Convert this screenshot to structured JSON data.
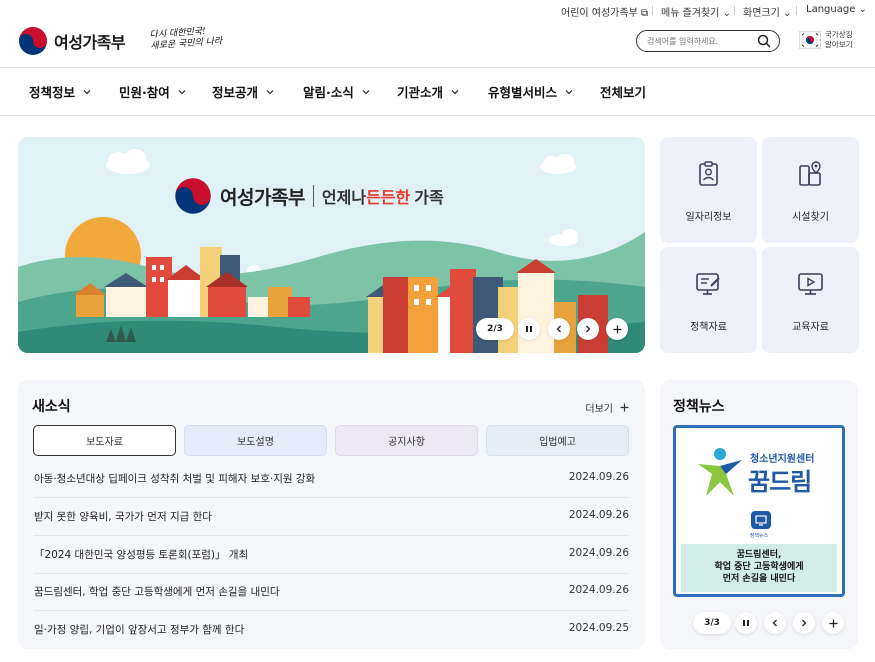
{
  "utility": {
    "kids": "어린이 여성가족부",
    "favorites": "메뉴 즐겨찾기",
    "screen_size": "화면크기",
    "language": "Language"
  },
  "header": {
    "logo_text": "여성가족부",
    "slogan_line1": "다시 대한민국!",
    "slogan_line2": "새로운 국민의 나라",
    "search_placeholder": "검색어를 입력하세요.",
    "symbol_line1": "국가상징",
    "symbol_line2": "알아보기"
  },
  "gnb": [
    "정책정보",
    "민원·참여",
    "정보공개",
    "알림·소식",
    "기관소개",
    "유형별서비스",
    "전체보기"
  ],
  "hero": {
    "brand": "여성가족부",
    "slogan_a": "언제나",
    "slogan_b": "든든한",
    "slogan_c": "가족",
    "counter": "2/3"
  },
  "quick_links": [
    {
      "label": "일자리정보",
      "icon": "id-badge-icon"
    },
    {
      "label": "시설찾기",
      "icon": "map-pin-icon"
    },
    {
      "label": "정책자료",
      "icon": "document-pen-icon"
    },
    {
      "label": "교육자료",
      "icon": "video-play-icon"
    }
  ],
  "news": {
    "title": "새소식",
    "more": "더보기",
    "tabs": [
      {
        "label": "보도자료",
        "bg": "#ffffff",
        "active": true
      },
      {
        "label": "보도설명",
        "bg": "#e4ecfb",
        "active": false
      },
      {
        "label": "공지사항",
        "bg": "#ede8f6",
        "active": false
      },
      {
        "label": "입법예고",
        "bg": "#e3eef7",
        "active": false
      }
    ],
    "items": [
      {
        "title": "아동·청소년대상 딥페이크 성착취 처벌 및 피해자 보호·지원 강화",
        "date": "2024.09.26"
      },
      {
        "title": "받지 못한 양육비, 국가가 먼저 지급 한다",
        "date": "2024.09.26"
      },
      {
        "title": "「2024 대한민국 양성평등 토론회(포럼)」 개최",
        "date": "2024.09.26"
      },
      {
        "title": "꿈드림센터, 학업 중단 고등학생에게 먼저 손길을 내민다",
        "date": "2024.09.26"
      },
      {
        "title": "일·가정 양립, 기업이 앞장서고 정부가 함께 한다",
        "date": "2024.09.25"
      }
    ]
  },
  "policy_news": {
    "title": "정책뉴스",
    "card_sub": "청소년지원센터",
    "card_main": "꿈드림",
    "card_tag": "정책뉴스",
    "card_line1": "꿈드림센터,",
    "card_line2": "학업 중단 고등학생에게",
    "card_line3": "먼저 손길을 내민다",
    "counter": "3/3"
  },
  "colors": {
    "accent": "#2d6fb8",
    "taegeuk_red": "#c8102e",
    "taegeuk_blue": "#003478",
    "highlight_red": "#e4392c"
  }
}
